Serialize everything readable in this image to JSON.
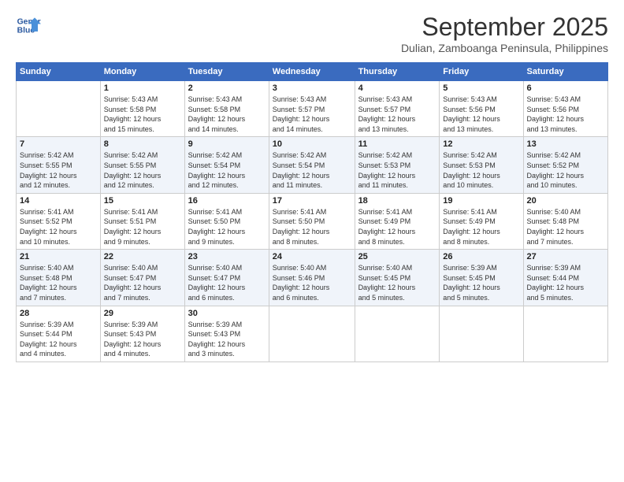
{
  "logo": {
    "line1": "General",
    "line2": "Blue"
  },
  "title": "September 2025",
  "location": "Dulian, Zamboanga Peninsula, Philippines",
  "days": [
    "Sunday",
    "Monday",
    "Tuesday",
    "Wednesday",
    "Thursday",
    "Friday",
    "Saturday"
  ],
  "weeks": [
    [
      {
        "day": "",
        "info": ""
      },
      {
        "day": "1",
        "info": "Sunrise: 5:43 AM\nSunset: 5:58 PM\nDaylight: 12 hours\nand 15 minutes."
      },
      {
        "day": "2",
        "info": "Sunrise: 5:43 AM\nSunset: 5:58 PM\nDaylight: 12 hours\nand 14 minutes."
      },
      {
        "day": "3",
        "info": "Sunrise: 5:43 AM\nSunset: 5:57 PM\nDaylight: 12 hours\nand 14 minutes."
      },
      {
        "day": "4",
        "info": "Sunrise: 5:43 AM\nSunset: 5:57 PM\nDaylight: 12 hours\nand 13 minutes."
      },
      {
        "day": "5",
        "info": "Sunrise: 5:43 AM\nSunset: 5:56 PM\nDaylight: 12 hours\nand 13 minutes."
      },
      {
        "day": "6",
        "info": "Sunrise: 5:43 AM\nSunset: 5:56 PM\nDaylight: 12 hours\nand 13 minutes."
      }
    ],
    [
      {
        "day": "7",
        "info": "Sunrise: 5:42 AM\nSunset: 5:55 PM\nDaylight: 12 hours\nand 12 minutes."
      },
      {
        "day": "8",
        "info": "Sunrise: 5:42 AM\nSunset: 5:55 PM\nDaylight: 12 hours\nand 12 minutes."
      },
      {
        "day": "9",
        "info": "Sunrise: 5:42 AM\nSunset: 5:54 PM\nDaylight: 12 hours\nand 12 minutes."
      },
      {
        "day": "10",
        "info": "Sunrise: 5:42 AM\nSunset: 5:54 PM\nDaylight: 12 hours\nand 11 minutes."
      },
      {
        "day": "11",
        "info": "Sunrise: 5:42 AM\nSunset: 5:53 PM\nDaylight: 12 hours\nand 11 minutes."
      },
      {
        "day": "12",
        "info": "Sunrise: 5:42 AM\nSunset: 5:53 PM\nDaylight: 12 hours\nand 10 minutes."
      },
      {
        "day": "13",
        "info": "Sunrise: 5:42 AM\nSunset: 5:52 PM\nDaylight: 12 hours\nand 10 minutes."
      }
    ],
    [
      {
        "day": "14",
        "info": "Sunrise: 5:41 AM\nSunset: 5:52 PM\nDaylight: 12 hours\nand 10 minutes."
      },
      {
        "day": "15",
        "info": "Sunrise: 5:41 AM\nSunset: 5:51 PM\nDaylight: 12 hours\nand 9 minutes."
      },
      {
        "day": "16",
        "info": "Sunrise: 5:41 AM\nSunset: 5:50 PM\nDaylight: 12 hours\nand 9 minutes."
      },
      {
        "day": "17",
        "info": "Sunrise: 5:41 AM\nSunset: 5:50 PM\nDaylight: 12 hours\nand 8 minutes."
      },
      {
        "day": "18",
        "info": "Sunrise: 5:41 AM\nSunset: 5:49 PM\nDaylight: 12 hours\nand 8 minutes."
      },
      {
        "day": "19",
        "info": "Sunrise: 5:41 AM\nSunset: 5:49 PM\nDaylight: 12 hours\nand 8 minutes."
      },
      {
        "day": "20",
        "info": "Sunrise: 5:40 AM\nSunset: 5:48 PM\nDaylight: 12 hours\nand 7 minutes."
      }
    ],
    [
      {
        "day": "21",
        "info": "Sunrise: 5:40 AM\nSunset: 5:48 PM\nDaylight: 12 hours\nand 7 minutes."
      },
      {
        "day": "22",
        "info": "Sunrise: 5:40 AM\nSunset: 5:47 PM\nDaylight: 12 hours\nand 7 minutes."
      },
      {
        "day": "23",
        "info": "Sunrise: 5:40 AM\nSunset: 5:47 PM\nDaylight: 12 hours\nand 6 minutes."
      },
      {
        "day": "24",
        "info": "Sunrise: 5:40 AM\nSunset: 5:46 PM\nDaylight: 12 hours\nand 6 minutes."
      },
      {
        "day": "25",
        "info": "Sunrise: 5:40 AM\nSunset: 5:45 PM\nDaylight: 12 hours\nand 5 minutes."
      },
      {
        "day": "26",
        "info": "Sunrise: 5:39 AM\nSunset: 5:45 PM\nDaylight: 12 hours\nand 5 minutes."
      },
      {
        "day": "27",
        "info": "Sunrise: 5:39 AM\nSunset: 5:44 PM\nDaylight: 12 hours\nand 5 minutes."
      }
    ],
    [
      {
        "day": "28",
        "info": "Sunrise: 5:39 AM\nSunset: 5:44 PM\nDaylight: 12 hours\nand 4 minutes."
      },
      {
        "day": "29",
        "info": "Sunrise: 5:39 AM\nSunset: 5:43 PM\nDaylight: 12 hours\nand 4 minutes."
      },
      {
        "day": "30",
        "info": "Sunrise: 5:39 AM\nSunset: 5:43 PM\nDaylight: 12 hours\nand 3 minutes."
      },
      {
        "day": "",
        "info": ""
      },
      {
        "day": "",
        "info": ""
      },
      {
        "day": "",
        "info": ""
      },
      {
        "day": "",
        "info": ""
      }
    ]
  ]
}
